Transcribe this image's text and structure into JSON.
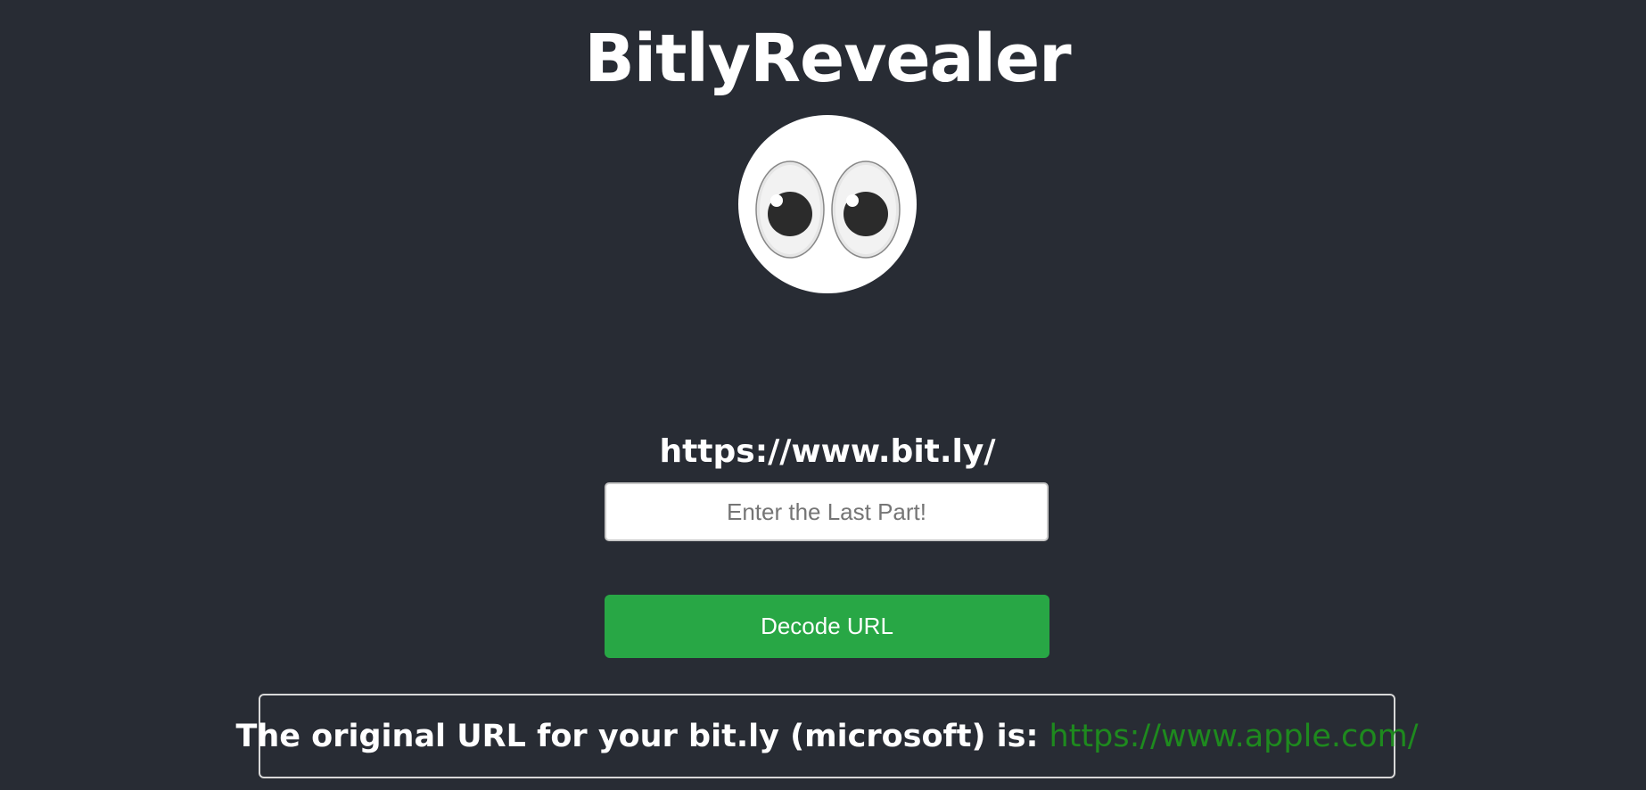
{
  "app": {
    "title": "BitlyRevealer",
    "logo_icon": "eyes-emoji-icon"
  },
  "form": {
    "url_prefix": "https://www.bit.ly/",
    "input_placeholder": "Enter the Last Part!",
    "input_value": "",
    "decode_button_label": "Decode URL"
  },
  "result": {
    "message": "The original URL for your bit.ly (microsoft) is:",
    "url": "https://www.apple.com/"
  },
  "colors": {
    "background": "#282c34",
    "button": "#28a745",
    "link": "#1e8a1e"
  }
}
